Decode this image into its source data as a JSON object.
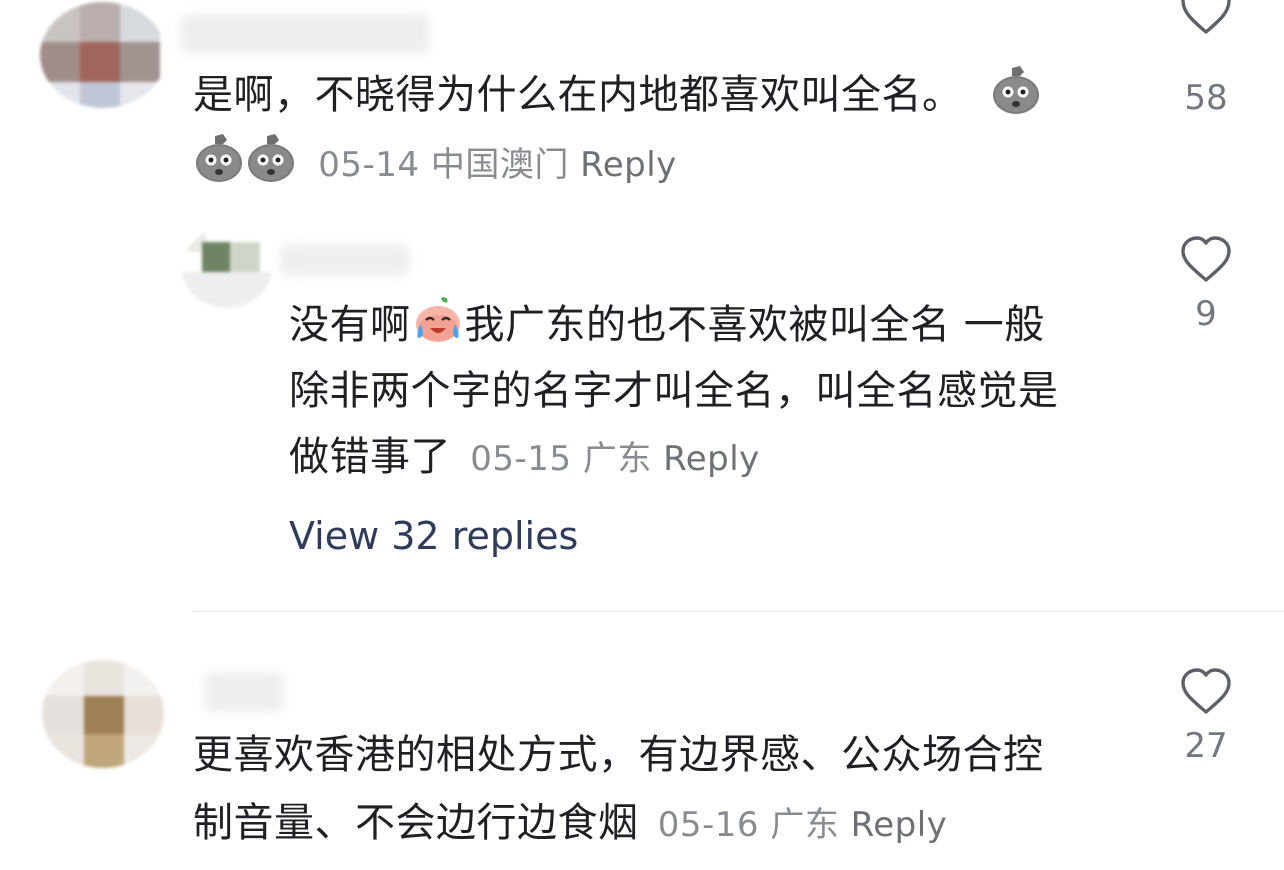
{
  "comments": [
    {
      "text": "是啊，不晓得为什么在内地都喜欢叫全名。",
      "date": "05-14",
      "location": "中国澳门",
      "reply_label": "Reply",
      "likes": "58"
    },
    {
      "text_line1": "没有啊",
      "text_line1b": "我广东的也不喜欢被叫全名  一般",
      "text_line2": "除非两个字的名字才叫全名，叫全名感觉是",
      "text_line3": "做错事了",
      "date": "05-15",
      "location": "广东",
      "reply_label": "Reply",
      "likes": "9",
      "view_replies": "View 32 replies"
    },
    {
      "text_line1": "更喜欢香港的相处方式，有边界感、公众场合控",
      "text_line2": "制音量、不会边行边食烟",
      "date": "05-16",
      "location": "广东",
      "reply_label": "Reply",
      "likes": "27"
    }
  ],
  "icons": {
    "like": "heart-outline-icon",
    "emoji_sticker": "potato-sack-face-emoji",
    "crying_emoji": "crying-peach-emoji"
  }
}
